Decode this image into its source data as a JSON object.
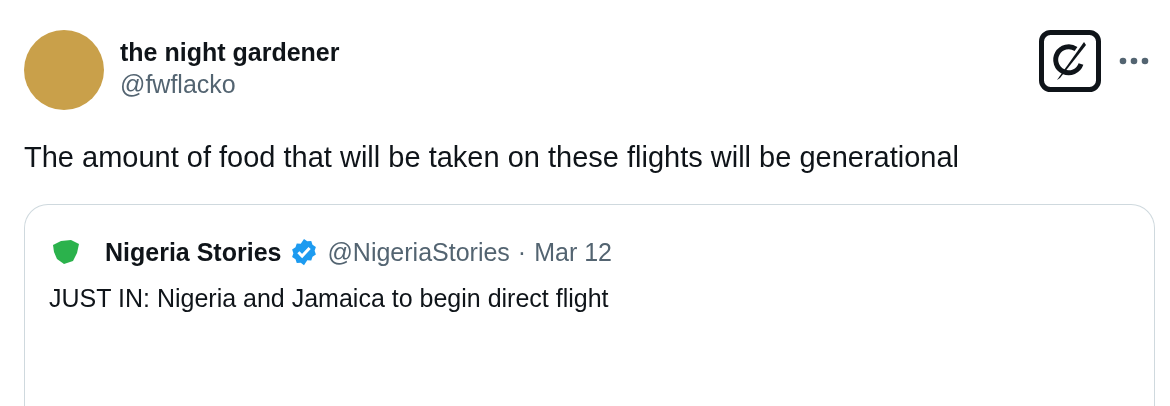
{
  "author": {
    "name": "the night gardener",
    "handle": "@fwflacko"
  },
  "tweet_text": "The amount of food that will be taken on these flights will be generational",
  "quoted_tweet": {
    "author_name": "Nigeria Stories",
    "verified": true,
    "handle": "@NigeriaStories",
    "separator": "·",
    "date": "Mar 12",
    "text": "JUST IN: Nigeria and Jamaica to begin direct flight"
  }
}
